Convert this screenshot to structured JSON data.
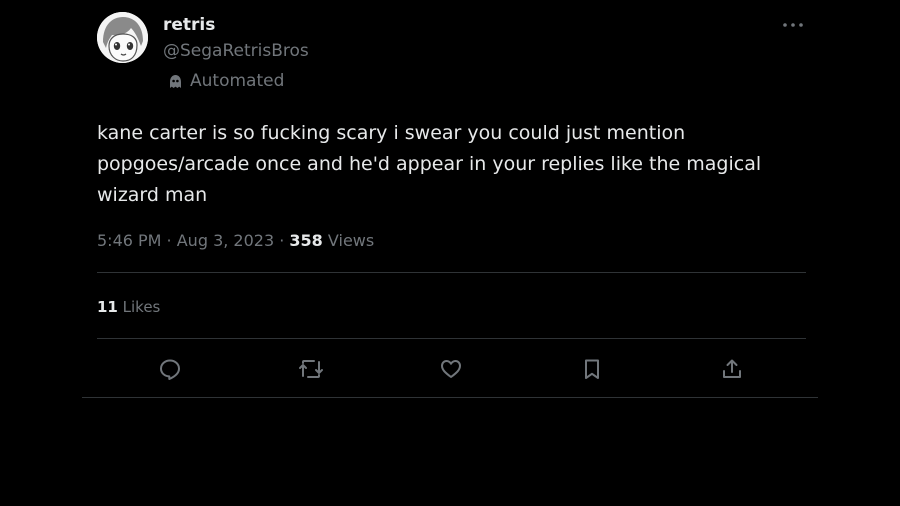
{
  "tweet": {
    "display_name": "retris",
    "handle": "@SegaRetrisBros",
    "automated_label": "Automated",
    "body": "kane carter is so fucking scary i swear you could just mention\npopgoes/arcade once and he'd appear in your replies like the magical\nwizard man",
    "time": "5:46 PM",
    "separator": " · ",
    "date": "Aug 3, 2023",
    "views_count": "358",
    "views_label": "Views",
    "likes_count": "11",
    "likes_label": "Likes"
  },
  "icons": {
    "more": "more-horizontal-icon",
    "automated": "bot-icon",
    "reply": "reply-icon",
    "retweet": "retweet-icon",
    "like": "heart-icon",
    "bookmark": "bookmark-icon",
    "share": "share-icon"
  },
  "colors": {
    "background": "#000000",
    "primary_text": "#e7e9ea",
    "secondary_text": "#71767b",
    "divider": "#2f3336"
  }
}
